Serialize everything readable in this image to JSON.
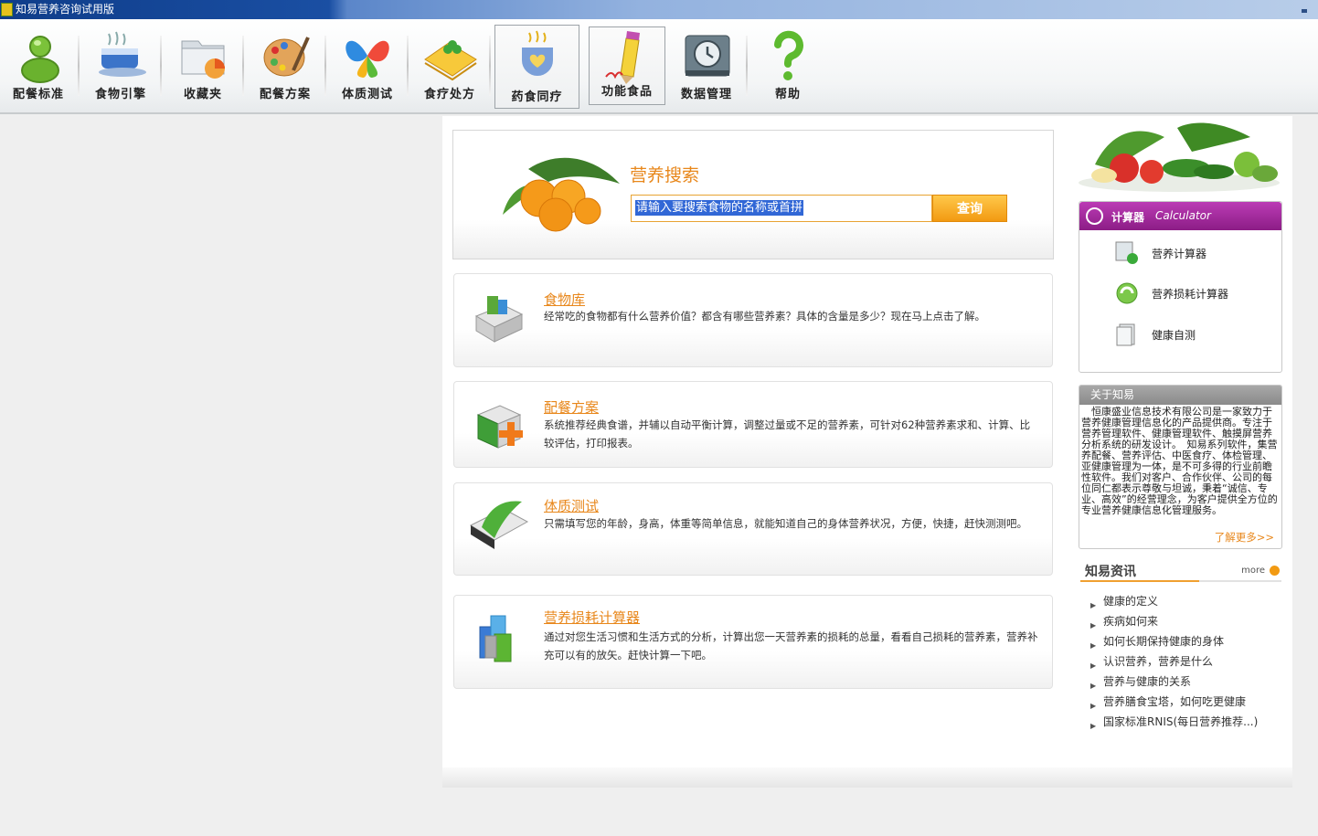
{
  "window": {
    "title": "知易营养咨询试用版"
  },
  "toolbar": {
    "items": [
      {
        "label": "配餐标准",
        "icon": "person-icon"
      },
      {
        "label": "食物引擎",
        "icon": "coffee-cup-icon"
      },
      {
        "label": "收藏夹",
        "icon": "folder-icon"
      },
      {
        "label": "配餐方案",
        "icon": "palette-icon"
      },
      {
        "label": "体质测试",
        "icon": "butterfly-icon"
      },
      {
        "label": "食疗处方",
        "icon": "notebook-icon"
      },
      {
        "label": "药食同疗",
        "icon": "heart-cup-icon"
      },
      {
        "label": "功能食品",
        "icon": "pencil-icon"
      },
      {
        "label": "数据管理",
        "icon": "backup-clock-icon"
      },
      {
        "label": "帮助",
        "icon": "question-icon"
      }
    ]
  },
  "search": {
    "title": "营养搜索",
    "input_value": "请输入要搜索食物的名称或首拼",
    "button_label": "查询"
  },
  "cards": [
    {
      "title": "食物库",
      "desc": "经常吃的食物都有什么营养价值？都含有哪些营养素？具体的含量是多少？现在马上点击了解。"
    },
    {
      "title": "配餐方案",
      "desc": "系统推荐经典食谱，并辅以自动平衡计算，调整过量或不足的营养素，可针对62种营养素求和、计算、比较评估，打印报表。"
    },
    {
      "title": "体质测试",
      "desc": "只需填写您的年龄，身高，体重等简单信息，就能知道自己的身体营养状况，方便，快捷，赶快测测吧。"
    },
    {
      "title": "营养损耗计算器",
      "desc": "通过对您生活习惯和生活方式的分析，计算出您一天营养素的损耗的总量，看看自己损耗的营养素，营养补充可以有的放矢。赶快计算一下吧。"
    }
  ],
  "calculator": {
    "title_cn": "计算器",
    "title_en": "Calculator",
    "items": [
      {
        "label": "营养计算器"
      },
      {
        "label": "营养损耗计算器"
      },
      {
        "label": "健康自测"
      }
    ]
  },
  "about": {
    "title": "关于知易",
    "body": "　恒康盛业信息技术有限公司是一家致力于营养健康管理信息化的产品提供商。专注于营养管理软件、健康管理软件、触摸屏营养分析系统的研发设计。　知易系列软件，集营养配餐、营养评估、中医食疗、体检管理、亚健康管理为一体，是不可多得的行业前瞻性软件。我们对客户、合作伙伴、公司的每位同仁都表示尊敬与坦诚，秉着“诚信、专业、高效”的经营理念，为客户提供全方位的专业营养健康信息化管理服务。",
    "more": "了解更多>>"
  },
  "news": {
    "title": "知易资讯",
    "more": "more",
    "items": [
      "健康的定义",
      "疾病如何来",
      "如何长期保持健康的身体",
      "认识营养，营养是什么",
      "营养与健康的关系",
      "营养膳食宝塔，如何吃更健康",
      "国家标准RNIS(每日营养推荐...)"
    ]
  }
}
